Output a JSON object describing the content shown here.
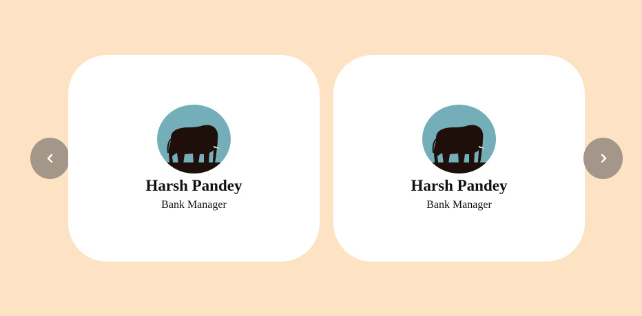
{
  "carousel": {
    "prev_button": {
      "icon": "chevron-left-icon"
    },
    "next_button": {
      "icon": "chevron-right-icon"
    },
    "cards": [
      {
        "name": "Harsh Pandey",
        "role": "Bank Manager",
        "avatar": "elephant-icon"
      },
      {
        "name": "Harsh Pandey",
        "role": "Bank Manager",
        "avatar": "elephant-icon"
      }
    ]
  },
  "colors": {
    "page_background": "#fde3c3",
    "card_background": "#ffffff",
    "nav_button": "#a49688",
    "avatar_sky": "#74aeb9",
    "elephant": "#1e0f0a"
  }
}
